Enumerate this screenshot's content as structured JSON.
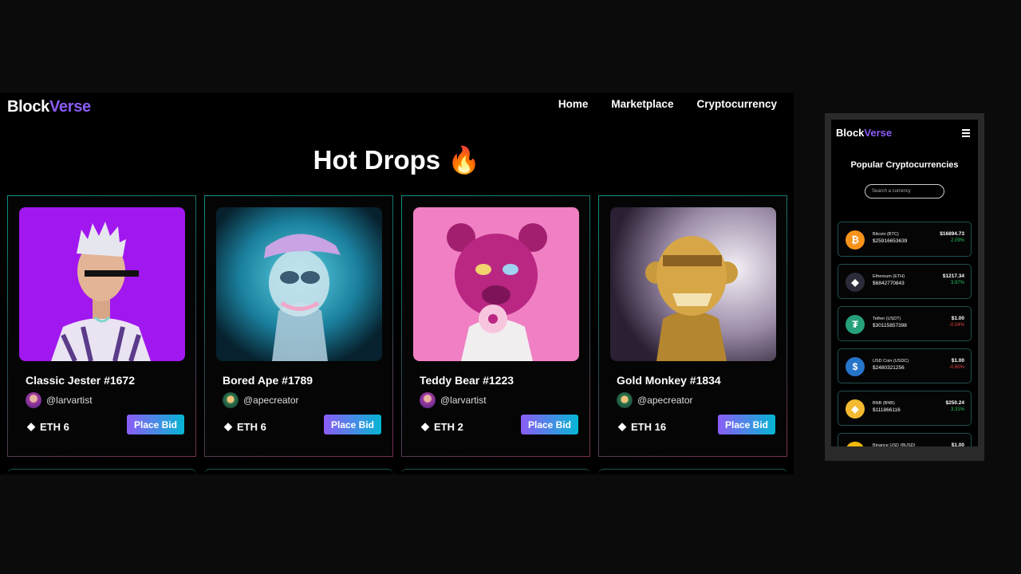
{
  "site": {
    "logo_part1": "Block",
    "logo_part2": "Verse"
  },
  "nav": {
    "items": [
      "Home",
      "Marketplace",
      "Cryptocurrency"
    ]
  },
  "page": {
    "title": "Hot Drops 🔥"
  },
  "cards": [
    {
      "name": "Classic Jester #1672",
      "creator": "@larvartist",
      "price": "ETH 6",
      "button": "Place Bid"
    },
    {
      "name": "Bored Ape #1789",
      "creator": "@apecreator",
      "price": "ETH 6",
      "button": "Place Bid"
    },
    {
      "name": "Teddy Bear #1223",
      "creator": "@larvartist",
      "price": "ETH 2",
      "button": "Place Bid"
    },
    {
      "name": "Gold Monkey #1834",
      "creator": "@apecreator",
      "price": "ETH 16",
      "button": "Place Bid"
    }
  ],
  "mobile": {
    "title": "Popular Cryptocurrencies",
    "search_placeholder": "Search a currency",
    "coins": [
      {
        "name": "Bitcoin (BTC)",
        "market_cap": "$25916653639",
        "price": "$16894.73",
        "change": "2.09%",
        "direction": "up",
        "icon": "₿",
        "color": "#f7931a"
      },
      {
        "name": "Ethereum (ETH)",
        "market_cap": "$6842770843",
        "price": "$1217.34",
        "change": "3.97%",
        "direction": "up",
        "icon": "◆",
        "color": "#2b2b3a"
      },
      {
        "name": "Tether (USDT)",
        "market_cap": "$30115857398",
        "price": "$1.00",
        "change": "-0.04%",
        "direction": "down",
        "icon": "₮",
        "color": "#26a17b"
      },
      {
        "name": "USD Coin (USDC)",
        "market_cap": "$2480321256",
        "price": "$1.00",
        "change": "-0.60%",
        "direction": "down",
        "icon": "$",
        "color": "#2775ca"
      },
      {
        "name": "BNB (BNB)",
        "market_cap": "$111866116",
        "price": "$250.24",
        "change": "3.31%",
        "direction": "up",
        "icon": "◈",
        "color": "#f3ba2f"
      },
      {
        "name": "Binance USD (BUSD)",
        "market_cap": "",
        "price": "$1.00",
        "change": "",
        "direction": "up",
        "icon": "◈",
        "color": "#f0b90b"
      }
    ]
  }
}
